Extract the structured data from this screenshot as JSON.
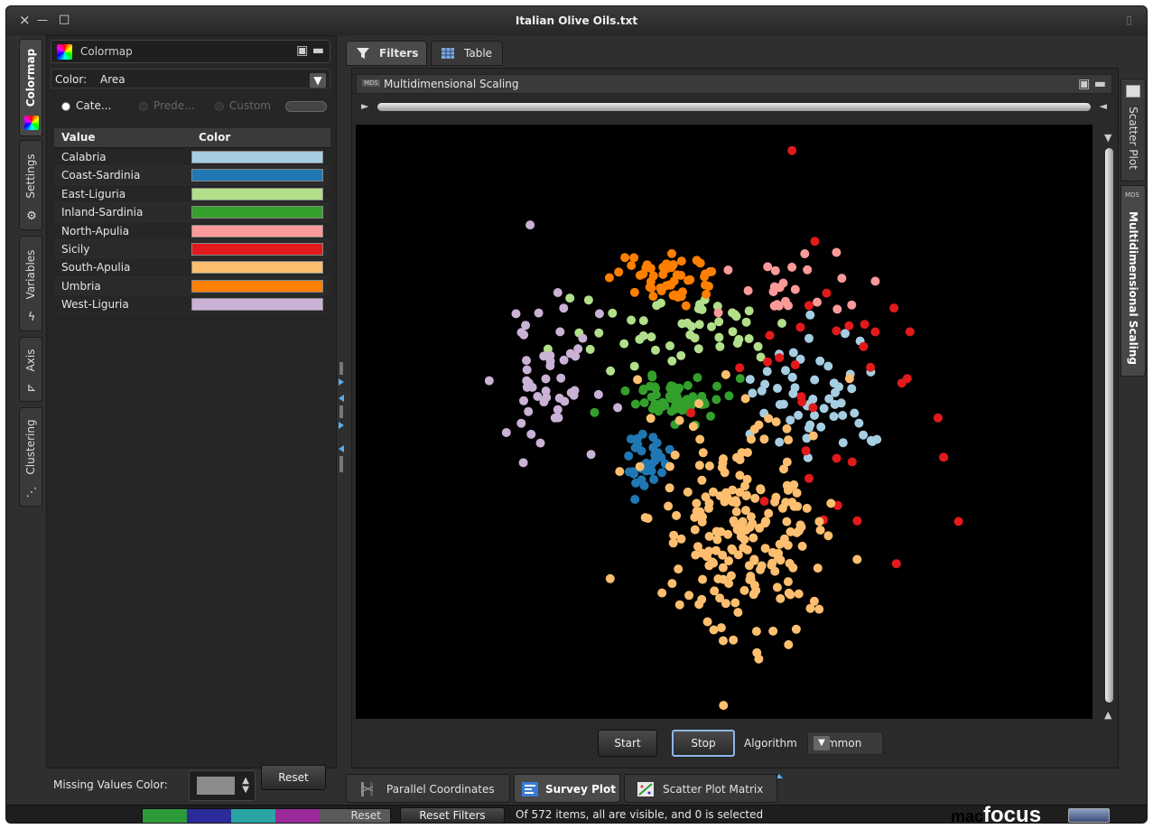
{
  "window": {
    "title": "Italian Olive Oils.txt",
    "controls": [
      "×",
      "—",
      "□"
    ]
  },
  "left_tabs": [
    {
      "label": "Colormap",
      "icon": "colormap-icon"
    },
    {
      "label": "Settings",
      "icon": "gear-icon"
    },
    {
      "label": "Variables",
      "icon": "lightning-icon"
    },
    {
      "label": "Axis",
      "icon": "axis-icon"
    },
    {
      "label": "Clustering",
      "icon": "clustering-icon"
    }
  ],
  "colormap": {
    "header": "Colormap",
    "color_label": "Color:",
    "color_value": "Area",
    "radios": [
      {
        "label": "Cate...",
        "selected": true
      },
      {
        "label": "Prede...",
        "selected": false
      },
      {
        "label": "Custom",
        "selected": false
      }
    ],
    "table": {
      "columns": [
        "Value",
        "Color"
      ],
      "rows": [
        {
          "value": "Calabria",
          "color": "#a6cee3"
        },
        {
          "value": "Coast-Sardinia",
          "color": "#1f78b4"
        },
        {
          "value": "East-Liguria",
          "color": "#b2df8a"
        },
        {
          "value": "Inland-Sardinia",
          "color": "#33a02c"
        },
        {
          "value": "North-Apulia",
          "color": "#fb9a99"
        },
        {
          "value": "Sicily",
          "color": "#e31a1c"
        },
        {
          "value": "South-Apulia",
          "color": "#fdbf6f"
        },
        {
          "value": "Umbria",
          "color": "#ff7f00"
        },
        {
          "value": "West-Liguria",
          "color": "#cab2d6"
        }
      ]
    },
    "missing_label": "Missing Values Color:",
    "missing_color": "#8c8c8c",
    "reset_label": "Reset"
  },
  "main_tabs": [
    {
      "label": "Filters",
      "active": true,
      "icon": "filter-icon"
    },
    {
      "label": "Table",
      "active": false,
      "icon": "table-icon"
    }
  ],
  "view": {
    "badge": "MDS",
    "title": "Multidimensional Scaling",
    "start_label": "Start",
    "stop_label": "Stop",
    "algorithm_label": "Algorithm",
    "algorithm_value": "Sammon"
  },
  "right_tabs": [
    {
      "label": "Scatter Plot",
      "active": false
    },
    {
      "label": "Multidimensional Scaling",
      "active": true
    }
  ],
  "bottom_tabs": [
    {
      "label": "Parallel Coordinates",
      "active": false,
      "icon": "parallel-coordinates-icon"
    },
    {
      "label": "Survey Plot",
      "active": true,
      "icon": "survey-plot-icon"
    },
    {
      "label": "Scatter Plot Matrix",
      "active": false,
      "icon": "scatter-matrix-icon"
    }
  ],
  "status": {
    "legend_colors": [
      "#2d9a3a",
      "#2b2b9a",
      "#2aa4a4",
      "#9a2a9a"
    ],
    "reset_label": "Reset",
    "reset_filters_label": "Reset Filters",
    "text": "Of 572 items, all are visible, and 0 is selected",
    "brand_prefix": "mac",
    "brand": "focus"
  },
  "chart_data": {
    "type": "scatter",
    "title": "",
    "xlabel": "",
    "ylabel": "",
    "xlim": [
      0,
      816
    ],
    "ylim": [
      0,
      658
    ],
    "series": [
      {
        "name": "Calabria",
        "color": "#a6cee3",
        "cluster": {
          "cx": 515,
          "cy": 300,
          "sx": 38,
          "sy": 34,
          "n": 56
        }
      },
      {
        "name": "Coast-Sardinia",
        "color": "#1f78b4",
        "cluster": {
          "cx": 318,
          "cy": 370,
          "sx": 14,
          "sy": 18,
          "n": 33
        }
      },
      {
        "name": "East-Liguria",
        "color": "#b2df8a",
        "cluster": {
          "cx": 355,
          "cy": 225,
          "sx": 62,
          "sy": 22,
          "n": 50
        }
      },
      {
        "name": "Inland-Sardinia",
        "color": "#33a02c",
        "cluster": {
          "cx": 355,
          "cy": 305,
          "sx": 26,
          "sy": 12,
          "n": 65
        }
      },
      {
        "name": "North-Apulia",
        "color": "#fb9a99",
        "cluster": {
          "cx": 470,
          "cy": 180,
          "sx": 38,
          "sy": 24,
          "n": 25
        }
      },
      {
        "name": "Sicily",
        "color": "#e31a1c",
        "cluster": {
          "cx": 545,
          "cy": 300,
          "sx": 60,
          "sy": 80,
          "n": 36
        }
      },
      {
        "name": "South-Apulia",
        "color": "#fdbf6f",
        "cluster": {
          "cx": 430,
          "cy": 440,
          "sx": 52,
          "sy": 62,
          "n": 206
        }
      },
      {
        "name": "Umbria",
        "color": "#ff7f00",
        "cluster": {
          "cx": 348,
          "cy": 172,
          "sx": 30,
          "sy": 12,
          "n": 51
        }
      },
      {
        "name": "West-Liguria",
        "color": "#cab2d6",
        "cluster": {
          "cx": 208,
          "cy": 280,
          "sx": 26,
          "sy": 42,
          "n": 50
        }
      }
    ],
    "legend": "none",
    "grid": false
  }
}
